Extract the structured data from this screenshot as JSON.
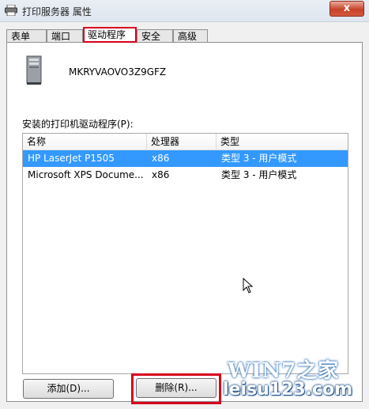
{
  "window": {
    "title": "打印服务器 属性",
    "close_label": "x"
  },
  "tabs": [
    {
      "label": "表单"
    },
    {
      "label": "端口"
    },
    {
      "label": "驱动程序"
    },
    {
      "label": "安全"
    },
    {
      "label": "高级"
    }
  ],
  "server_name": "MKRYVAOVO3Z9GFZ",
  "drivers_label": "安装的打印机驱动程序(P):",
  "columns": [
    "名称",
    "处理器",
    "类型"
  ],
  "rows": [
    {
      "name": "HP LaserJet P1505",
      "processor": "x86",
      "type": "类型 3 - 用户模式",
      "selected": true
    },
    {
      "name": "Microsoft XPS Docume...",
      "processor": "x86",
      "type": "类型 3 - 用户模式",
      "selected": false
    }
  ],
  "buttons": {
    "add": "添加(D)...",
    "remove": "删除(R)..."
  },
  "watermark": {
    "line1": "WIN7之家",
    "line2": "leisu123.com"
  },
  "colors": {
    "selection": "#3399ff",
    "highlight": "#d7001d"
  }
}
